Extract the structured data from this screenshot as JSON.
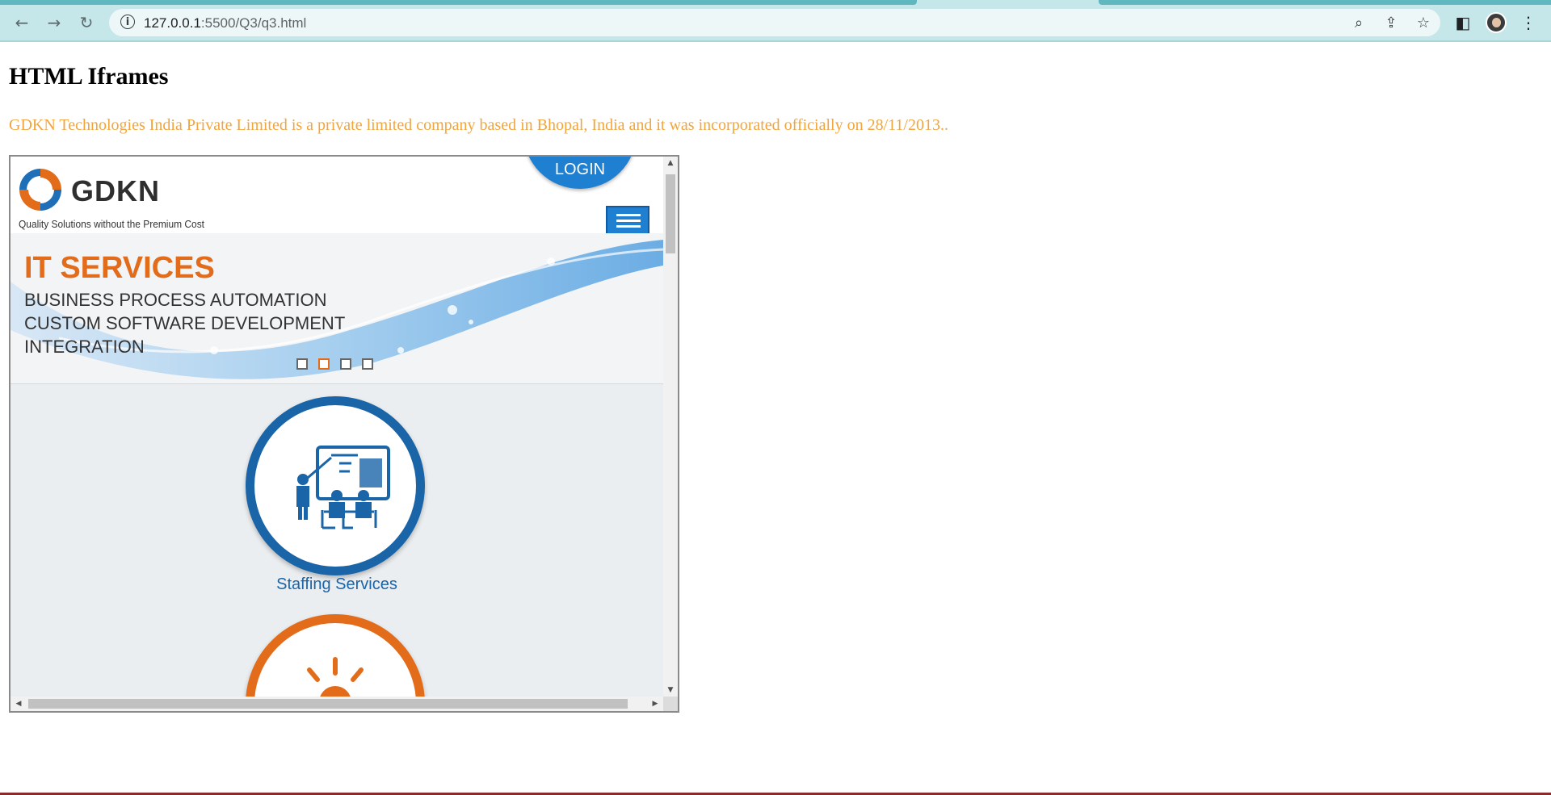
{
  "browser": {
    "url_host": "127.0.0.1",
    "url_rest": ":5500/Q3/q3.html",
    "back_icon": "back-arrow-icon",
    "forward_icon": "forward-arrow-icon",
    "reload_icon": "reload-icon"
  },
  "page": {
    "heading": "HTML Iframes",
    "paragraph": "GDKN Technologies India Private Limited is a private limited company based in Bhopal, India and it was incorporated officially on 28/11/2013..",
    "paragraph_color": "#f2a53c"
  },
  "iframe": {
    "logo_text": "GDKN",
    "tagline": "Quality Solutions without the Premium Cost",
    "login_label": "LOGIN",
    "banner": {
      "title": "IT SERVICES",
      "lines": [
        "BUSINESS PROCESS AUTOMATION",
        "CUSTOM SOFTWARE DEVELOPMENT",
        "INTEGRATION"
      ],
      "slides": 4,
      "active_slide": 2
    },
    "services": [
      {
        "label": "Staffing Services",
        "color": "#1a64a8",
        "icon": "presentation-training-icon"
      },
      {
        "label": "",
        "color": "#e36c1b",
        "icon": "lightbulb-icon"
      }
    ],
    "accent": "#1f7fd0",
    "orange": "#e36c1b"
  }
}
